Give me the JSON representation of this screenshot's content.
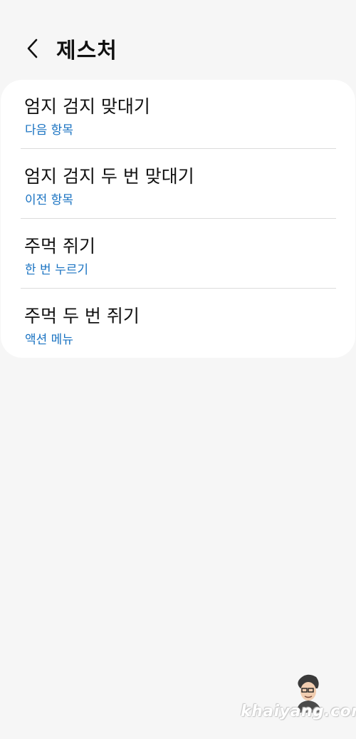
{
  "header": {
    "back_icon": "chevron-left-icon",
    "title": "제스처"
  },
  "gestures": [
    {
      "title": "엄지 검지 맞대기",
      "action": "다음 항목"
    },
    {
      "title": "엄지 검지 두 번 맞대기",
      "action": "이전 항목"
    },
    {
      "title": "주먹 쥐기",
      "action": "한 번 누르기"
    },
    {
      "title": "주먹 두 번 쥐기",
      "action": "액션 메뉴"
    }
  ],
  "watermark": {
    "text": "khaiyang.com"
  },
  "colors": {
    "background": "#f6f6f6",
    "card": "#ffffff",
    "accent": "#1a73c2",
    "text": "#111111"
  }
}
